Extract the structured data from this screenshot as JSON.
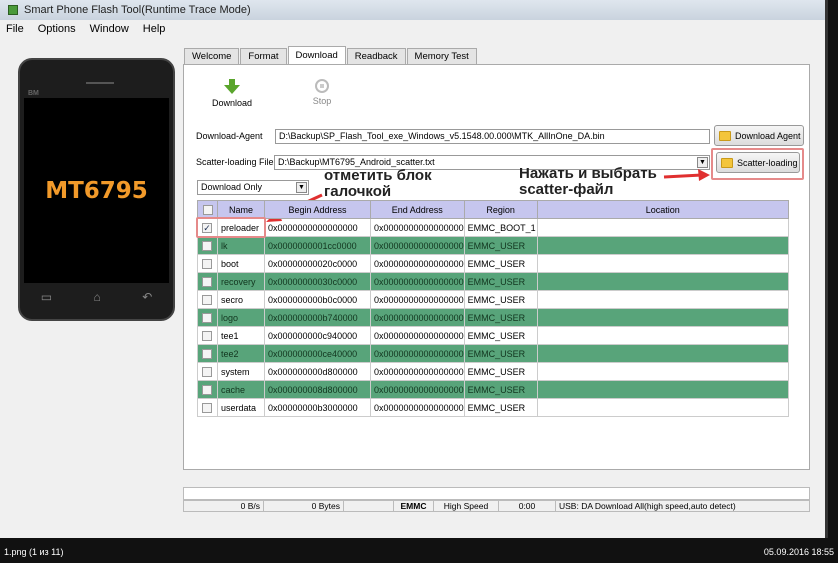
{
  "window": {
    "title": "Smart Phone Flash Tool(Runtime Trace Mode)"
  },
  "menu": [
    "File",
    "Options",
    "Window",
    "Help"
  ],
  "phone": {
    "model": "MT6795",
    "brand": "BM"
  },
  "tabs": [
    "Welcome",
    "Format",
    "Download",
    "Readback",
    "Memory Test"
  ],
  "toolbar": {
    "download": "Download",
    "stop": "Stop"
  },
  "download_agent": {
    "label": "Download-Agent",
    "value": "D:\\Backup\\SP_Flash_Tool_exe_Windows_v5.1548.00.000\\MTK_AllInOne_DA.bin",
    "button": "Download Agent"
  },
  "scatter": {
    "label": "Scatter-loading File",
    "value": "D:\\Backup\\MT6795_Android_scatter.txt",
    "button": "Scatter-loading"
  },
  "mode": {
    "selected": "Download Only"
  },
  "annotations": {
    "check": "отметить блок\nгалочкой",
    "scatter": "Нажать и выбрать\nscatter-файл"
  },
  "table": {
    "headers": [
      "Name",
      "Begin Address",
      "End Address",
      "Region",
      "Location"
    ],
    "rows": [
      {
        "checked": true,
        "name": "preloader",
        "begin": "0x0000000000000000",
        "end": "0x0000000000000000",
        "region": "EMMC_BOOT_1",
        "location": ""
      },
      {
        "checked": false,
        "name": "lk",
        "begin": "0x0000000001cc0000",
        "end": "0x0000000000000000",
        "region": "EMMC_USER",
        "location": ""
      },
      {
        "checked": false,
        "name": "boot",
        "begin": "0x00000000020c0000",
        "end": "0x0000000000000000",
        "region": "EMMC_USER",
        "location": ""
      },
      {
        "checked": false,
        "name": "recovery",
        "begin": "0x00000000030c0000",
        "end": "0x0000000000000000",
        "region": "EMMC_USER",
        "location": ""
      },
      {
        "checked": false,
        "name": "secro",
        "begin": "0x000000000b0c0000",
        "end": "0x0000000000000000",
        "region": "EMMC_USER",
        "location": ""
      },
      {
        "checked": false,
        "name": "logo",
        "begin": "0x000000000b740000",
        "end": "0x0000000000000000",
        "region": "EMMC_USER",
        "location": ""
      },
      {
        "checked": false,
        "name": "tee1",
        "begin": "0x000000000c940000",
        "end": "0x0000000000000000",
        "region": "EMMC_USER",
        "location": ""
      },
      {
        "checked": false,
        "name": "tee2",
        "begin": "0x000000000ce40000",
        "end": "0x0000000000000000",
        "region": "EMMC_USER",
        "location": ""
      },
      {
        "checked": false,
        "name": "system",
        "begin": "0x000000000d800000",
        "end": "0x0000000000000000",
        "region": "EMMC_USER",
        "location": ""
      },
      {
        "checked": false,
        "name": "cache",
        "begin": "0x000000008d800000",
        "end": "0x0000000000000000",
        "region": "EMMC_USER",
        "location": ""
      },
      {
        "checked": false,
        "name": "userdata",
        "begin": "0x00000000b3000000",
        "end": "0x0000000000000000",
        "region": "EMMC_USER",
        "location": ""
      }
    ]
  },
  "status": {
    "speed": "0 B/s",
    "bytes": "0 Bytes",
    "storage": "EMMC",
    "usb_speed": "High Speed",
    "time": "0:00",
    "message": "USB: DA Download All(high speed,auto detect)"
  },
  "viewer": {
    "file": "1.png (1 из 11)",
    "datetime": "05.09.2016 18:55"
  },
  "colors": {
    "green_row": "#58a47a",
    "header": "#c6c6ee",
    "highlight": "#e58a8a",
    "arrow": "#e03030"
  }
}
